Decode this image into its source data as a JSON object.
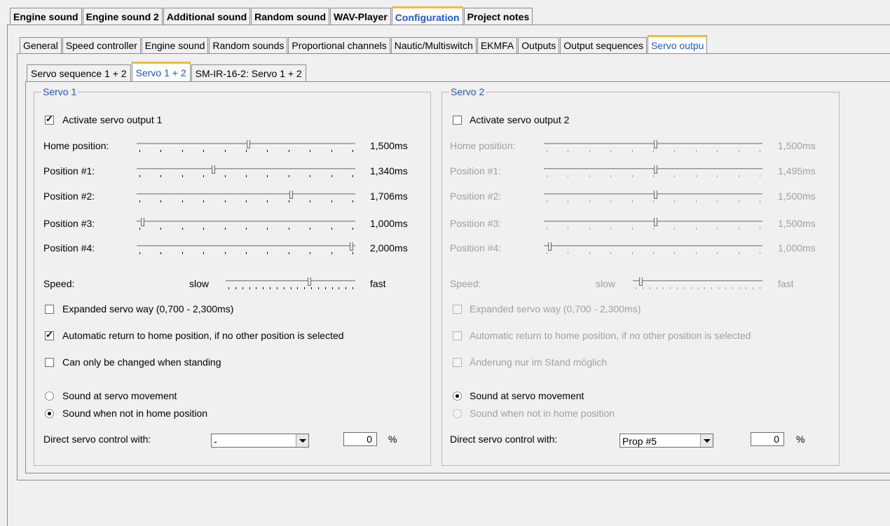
{
  "top_tabs": [
    "Engine sound",
    "Engine sound 2",
    "Additional sound",
    "Random sound",
    "WAV-Player",
    "Configuration",
    "Project notes"
  ],
  "second_tabs": [
    "General",
    "Speed controller",
    "Engine sound",
    "Random sounds",
    "Proportional channels",
    "Nautic/Multiswitch",
    "EKMFA",
    "Outputs",
    "Output sequences",
    "Servo outpu"
  ],
  "third_tabs": [
    "Servo sequence  1 + 2",
    "Servo 1 + 2",
    "SM-IR-16-2: Servo 1 + 2"
  ],
  "servo1": {
    "title": "Servo 1",
    "activate": "Activate servo output 1",
    "activate_checked": true,
    "positions": [
      {
        "label": "Home position:",
        "value": "1,500ms",
        "frac": 0.51
      },
      {
        "label": "Position #1:",
        "value": "1,340ms",
        "frac": 0.35
      },
      {
        "label": "Position #2:",
        "value": "1,706ms",
        "frac": 0.71
      },
      {
        "label": "Position #3:",
        "value": "1,000ms",
        "frac": 0.02
      },
      {
        "label": "Position #4:",
        "value": "2,000ms",
        "frac": 0.99
      }
    ],
    "speed_label": "Speed:",
    "slow": "slow",
    "fast": "fast",
    "speed_frac": 0.65,
    "expanded": "Expanded servo way (0,700 - 2,300ms)",
    "auto_return": "Automatic return to home position, if no other position is selected",
    "auto_return_checked": true,
    "standing": "Can only be changed when standing",
    "radio1": "Sound at servo movement",
    "radio2": "Sound when not in home position",
    "radio_selected": 2,
    "direct": "Direct servo control with:",
    "direct_value": "-",
    "percent_value": "0",
    "percent": "%"
  },
  "servo2": {
    "title": "Servo 2",
    "activate": "Activate servo output 2",
    "activate_checked": false,
    "positions": [
      {
        "label": "Home position:",
        "value": "1,500ms",
        "frac": 0.51
      },
      {
        "label": "Position #1:",
        "value": "1,495ms",
        "frac": 0.51
      },
      {
        "label": "Position #2:",
        "value": "1,500ms",
        "frac": 0.51
      },
      {
        "label": "Position #3:",
        "value": "1,500ms",
        "frac": 0.51
      },
      {
        "label": "Position #4:",
        "value": "1,000ms",
        "frac": 0.02
      }
    ],
    "speed_label": "Speed:",
    "slow": "slow",
    "fast": "fast",
    "speed_frac": 0.05,
    "expanded": "Expanded servo way (0,700 - 2,300ms)",
    "auto_return": "Automatic return to home position, if no other position is selected",
    "standing": "Änderung nur im Stand möglich",
    "radio1": "Sound at servo movement",
    "radio2": "Sound when not in home position",
    "radio_selected": 1,
    "direct": "Direct servo control with:",
    "direct_value": "Prop #5",
    "percent_value": "0",
    "percent": "%"
  }
}
